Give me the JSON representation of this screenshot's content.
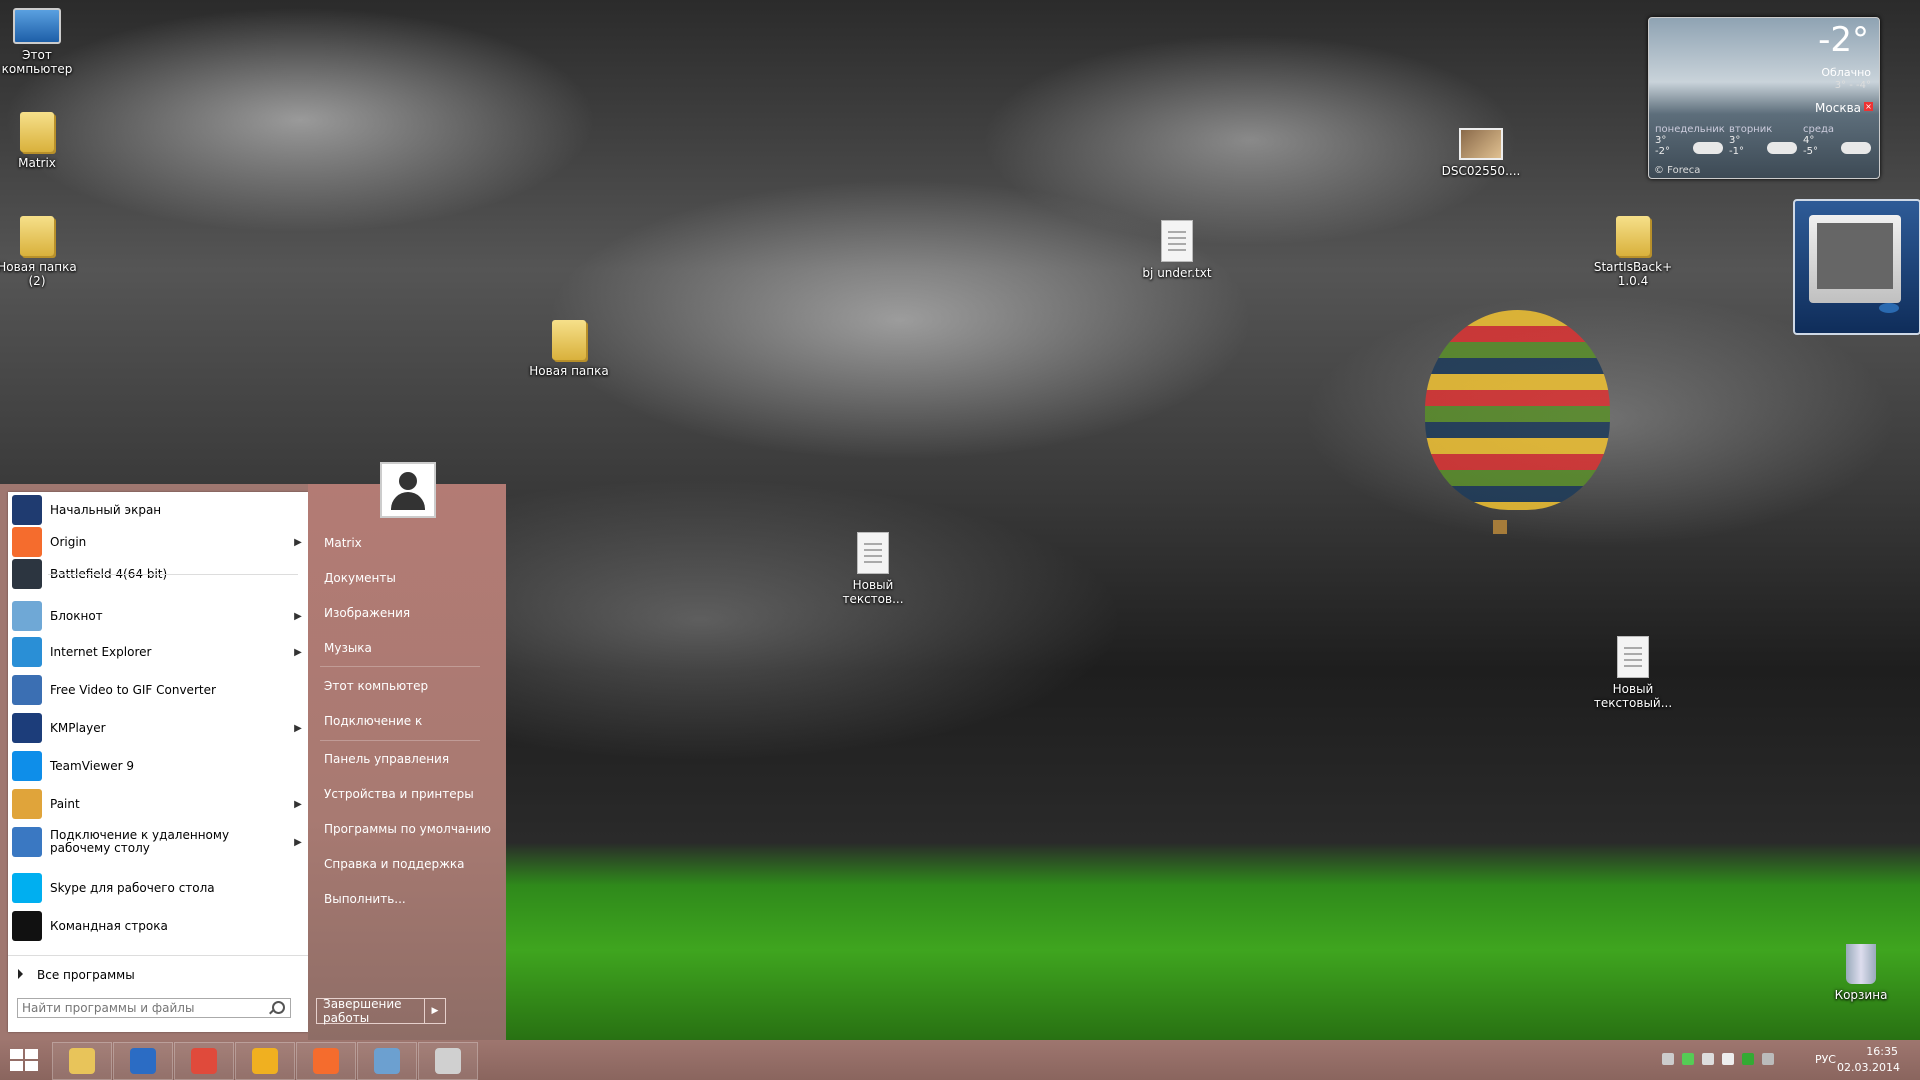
{
  "desktop_icons": [
    {
      "label": "Этот компьютер",
      "icon": "computer-icon"
    },
    {
      "label": "Matrix",
      "icon": "user-folder-icon"
    },
    {
      "label": "Новая папка (2)",
      "icon": "folder-icon"
    },
    {
      "label": "Новая папка",
      "icon": "folder-icon"
    },
    {
      "label": "DSC02550....",
      "icon": "image-file-icon"
    },
    {
      "label": "bj under.txt",
      "icon": "text-file-icon"
    },
    {
      "label": "StartIsBack+ 1.0.4",
      "icon": "folder-icon"
    },
    {
      "label": "Новый текстов...",
      "icon": "text-file-icon"
    },
    {
      "label": "Новый текстовый...",
      "icon": "text-file-icon"
    },
    {
      "label": "Корзина",
      "icon": "recycle-bin-icon"
    }
  ],
  "weather": {
    "temperature": "-2°",
    "condition": "Облачно",
    "range": "3° - -4°",
    "city": "Москва",
    "days": [
      {
        "name": "понедельник",
        "high": "3°",
        "low": "-2°"
      },
      {
        "name": "вторник",
        "high": "3°",
        "low": "-1°"
      },
      {
        "name": "среда",
        "high": "4°",
        "low": "-5°"
      }
    ],
    "credit": "© Foreca"
  },
  "start_menu": {
    "programs": [
      {
        "label": "Начальный экран",
        "has_submenu": false,
        "icon": "start-screen-icon",
        "color": "#1f3b70"
      },
      {
        "label": "Origin",
        "has_submenu": true,
        "icon": "origin-icon",
        "color": "#f56c2d"
      },
      {
        "label": "Battlefield 4(64 bit)",
        "has_submenu": false,
        "icon": "battlefield-icon",
        "color": "#2c3540"
      },
      {
        "label": "Блокнот",
        "has_submenu": true,
        "icon": "notepad-icon",
        "color": "#6fa8d6"
      },
      {
        "label": "Internet Explorer",
        "has_submenu": true,
        "icon": "ie-icon",
        "color": "#2a8fd6"
      },
      {
        "label": "Free Video to GIF Converter",
        "has_submenu": false,
        "icon": "gif-converter-icon",
        "color": "#3b6fb3"
      },
      {
        "label": "KMPlayer",
        "has_submenu": true,
        "icon": "kmplayer-icon",
        "color": "#1c3d7a"
      },
      {
        "label": "TeamViewer 9",
        "has_submenu": false,
        "icon": "teamviewer-icon",
        "color": "#0e8ee9"
      },
      {
        "label": "Paint",
        "has_submenu": true,
        "icon": "paint-icon",
        "color": "#e0a43a"
      },
      {
        "label": "Подключение к удаленному рабочему столу",
        "has_submenu": true,
        "icon": "remote-desktop-icon",
        "color": "#3a78c2"
      },
      {
        "label": "Skype для рабочего стола",
        "has_submenu": false,
        "icon": "skype-icon",
        "color": "#00aff0"
      },
      {
        "label": "Командная строка",
        "has_submenu": false,
        "icon": "cmd-icon",
        "color": "#111111"
      }
    ],
    "all_programs": "Все программы",
    "search_placeholder": "Найти программы и файлы",
    "places": [
      "Matrix",
      "Документы",
      "Изображения",
      "Музыка",
      "Этот компьютер",
      "Подключение к",
      "Панель управления",
      "Устройства и принтеры",
      "Программы по умолчанию",
      "Справка и поддержка",
      "Выполнить..."
    ],
    "shutdown_label": "Завершение работы"
  },
  "taskbar": {
    "pinned": [
      {
        "name": "explorer",
        "icon": "explorer-icon",
        "color": "#e8c45a"
      },
      {
        "name": "media",
        "icon": "film-icon",
        "color": "#2b6cc4"
      },
      {
        "name": "chrome",
        "icon": "chrome-icon",
        "color": "#e04a3b"
      },
      {
        "name": "aimp",
        "icon": "aimp-icon",
        "color": "#f0b020"
      },
      {
        "name": "origin",
        "icon": "origin-icon",
        "color": "#f56c2d"
      },
      {
        "name": "monitor",
        "icon": "monitor-icon",
        "color": "#6ca0d0"
      },
      {
        "name": "paint",
        "icon": "paint-icon",
        "color": "#d0d0d0"
      }
    ],
    "language": "РУС",
    "time": "16:35",
    "date": "02.03.2014"
  }
}
